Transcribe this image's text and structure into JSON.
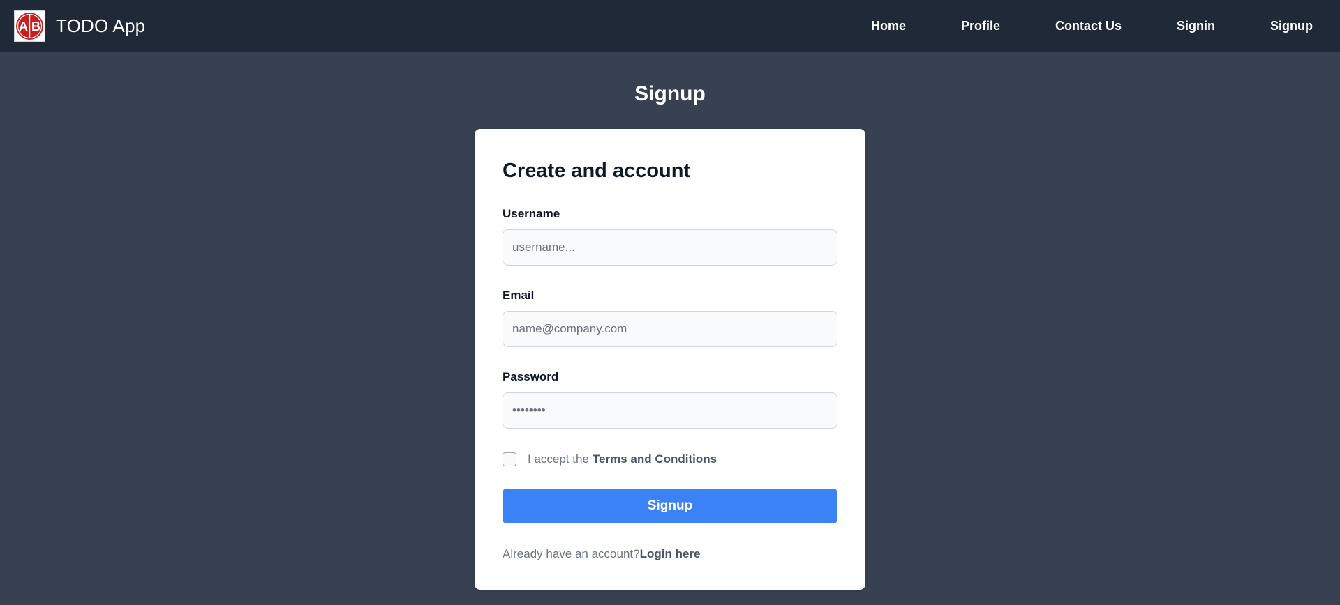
{
  "app": {
    "brand_name": "TODO App",
    "logo_letters": [
      "A",
      "B"
    ]
  },
  "nav": {
    "items": [
      {
        "label": "Home"
      },
      {
        "label": "Profile"
      },
      {
        "label": "Contact Us"
      },
      {
        "label": "Signin"
      },
      {
        "label": "Signup"
      }
    ]
  },
  "page": {
    "title": "Signup"
  },
  "form": {
    "heading": "Create and account",
    "username": {
      "label": "Username",
      "placeholder": "username..."
    },
    "email": {
      "label": "Email",
      "placeholder": "name@company.com"
    },
    "password": {
      "label": "Password",
      "placeholder": "••••••••"
    },
    "terms": {
      "text": "I accept the",
      "link": "Terms and Conditions"
    },
    "submit_label": "Signup",
    "footer": {
      "text": "Already have an account?",
      "link": "Login here"
    }
  },
  "colors": {
    "navbar_bg": "#1f2937",
    "page_bg": "#374151",
    "button_bg": "#3b82f6",
    "logo_red": "#c81e1e"
  }
}
